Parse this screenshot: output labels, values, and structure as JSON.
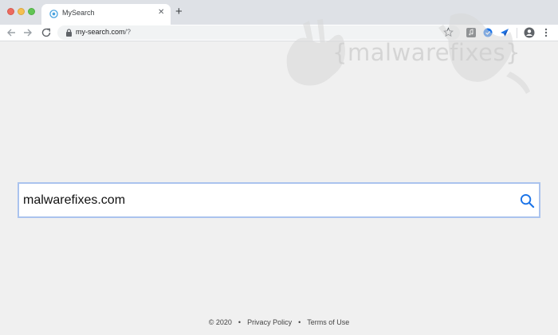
{
  "browser": {
    "tab": {
      "title": "MySearch",
      "favicon": "mysearch-favicon-icon",
      "close": "✕"
    },
    "new_tab": "+",
    "url": {
      "host": "my-search.com",
      "path": "/?"
    },
    "extensions": [
      "music-extension-icon",
      "shield-extension-icon",
      "send-extension-icon"
    ]
  },
  "watermark": {
    "text": "{malwarefixes}"
  },
  "search": {
    "value": "malwarefixes.com",
    "icon": "search-icon"
  },
  "footer": {
    "copyright": "© 2020",
    "separator": "•",
    "privacy": "Privacy Policy",
    "terms": "Terms of Use"
  },
  "colors": {
    "page_bg": "#f0f0f0",
    "tabstrip_bg": "#dee1e6",
    "search_border": "#aac3ee",
    "search_icon": "#1a73e8"
  }
}
